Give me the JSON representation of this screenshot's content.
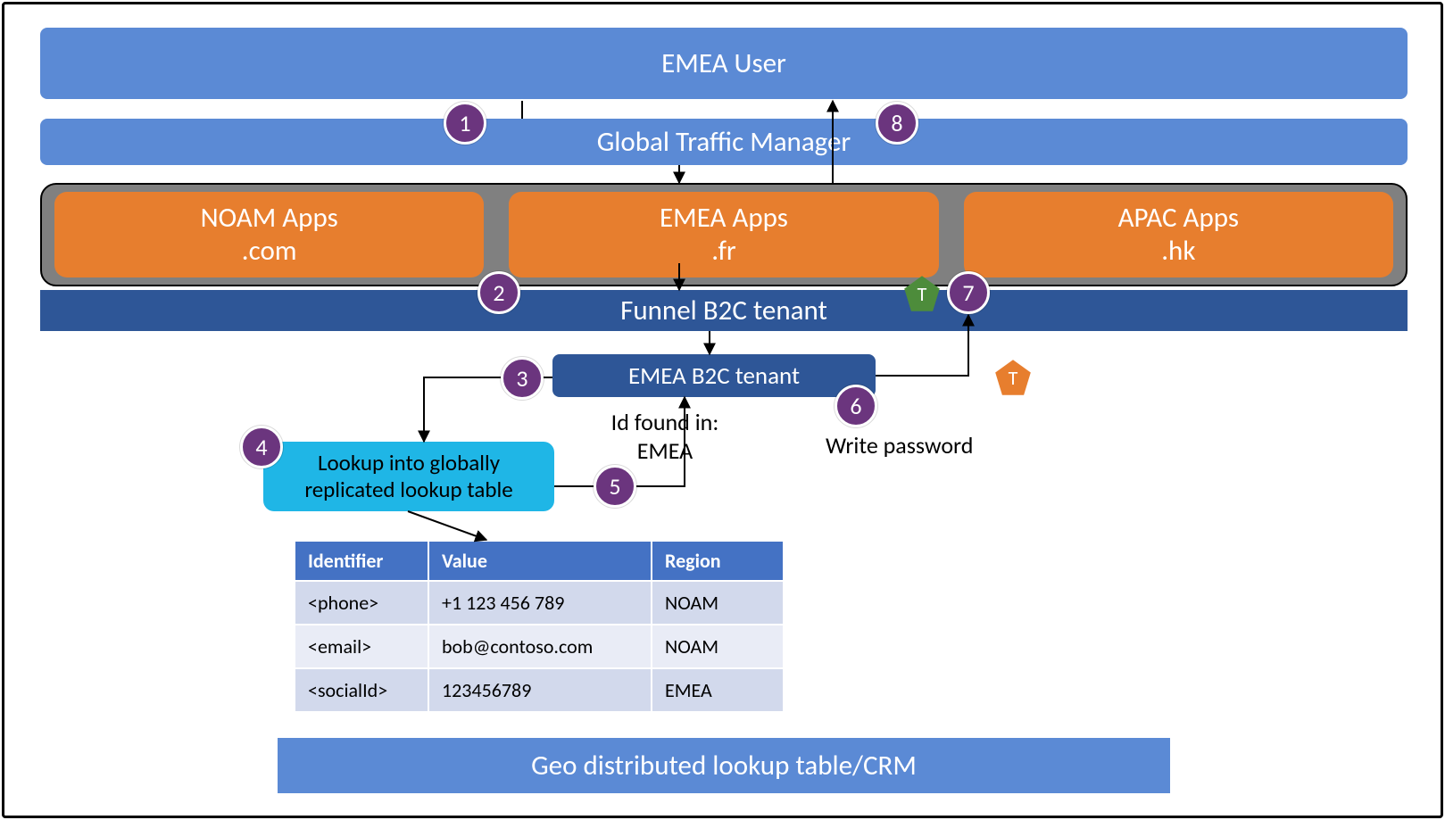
{
  "bars": {
    "emea_user": "EMEA User",
    "gtm": "Global Traffic Manager",
    "funnel": "Funnel B2C tenant",
    "emea_b2c": "EMEA B2C tenant",
    "lookup_line1": "Lookup into globally",
    "lookup_line2": "replicated lookup table",
    "footer": "Geo distributed lookup table/CRM"
  },
  "apps": {
    "noam": {
      "title": "NOAM Apps",
      "domain": ".com"
    },
    "emea": {
      "title": "EMEA Apps",
      "domain": ".fr"
    },
    "apac": {
      "title": "APAC Apps",
      "domain": ".hk"
    }
  },
  "steps": {
    "s1": "1",
    "s2": "2",
    "s3": "3",
    "s4": "4",
    "s5": "5",
    "s6": "6",
    "s7": "7",
    "s8": "8"
  },
  "tokens": {
    "green": "T",
    "orange": "T"
  },
  "labels": {
    "id_found_l1": "Id found in:",
    "id_found_l2": "EMEA",
    "write_pw": "Write password"
  },
  "table": {
    "headers": {
      "identifier": "Identifier",
      "value": "Value",
      "region": "Region"
    },
    "rows": [
      {
        "identifier": "<phone>",
        "value": "+1 123 456 789",
        "region": "NOAM"
      },
      {
        "identifier": "<email>",
        "value": "bob@contoso.com",
        "region": "NOAM"
      },
      {
        "identifier": "<socialId>",
        "value": "123456789",
        "region": "EMEA"
      }
    ]
  },
  "colors": {
    "blue_light": "#5b8ad5",
    "blue_dark": "#2e5697",
    "orange": "#e77e2e",
    "green": "#4d8c3b",
    "purple": "#6b357e",
    "cyan": "#1fb6e6",
    "table_header": "#4472c4"
  }
}
